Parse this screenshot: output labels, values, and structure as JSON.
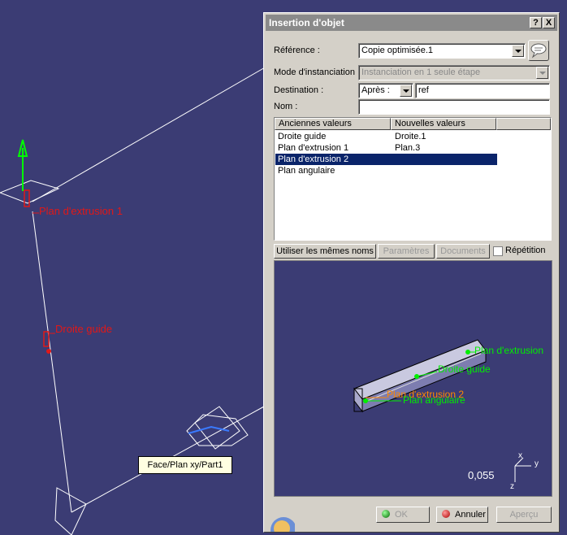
{
  "viewport": {
    "labels": {
      "plan_extrusion_1": "Plan d'extrusion 1",
      "droite_guide": "Droite guide"
    },
    "tooltip": "Face/Plan xy/Part1"
  },
  "dialog": {
    "title": "Insertion d'objet",
    "help_button": "?",
    "close_button": "X",
    "reference": {
      "label": "Référence :",
      "value": "Copie optimisée.1"
    },
    "mode": {
      "label": "Mode d'instanciation :",
      "value": "Instanciation en 1 seule étape"
    },
    "destination": {
      "label": "Destination :",
      "position": "Après :",
      "value": "ref"
    },
    "nom": {
      "label": "Nom :",
      "value": ""
    },
    "table": {
      "headers": [
        "Anciennes valeurs",
        "Nouvelles valeurs"
      ],
      "rows": [
        {
          "old": "Droite guide",
          "new": "Droite.1"
        },
        {
          "old": "Plan d'extrusion 1",
          "new": "Plan.3"
        },
        {
          "old": "Plan d'extrusion 2",
          "new": ""
        },
        {
          "old": "Plan angulaire",
          "new": ""
        }
      ],
      "selected_index": 2
    },
    "buttons": {
      "same_names": "Utiliser les mêmes noms",
      "parametres": "Paramètres",
      "documents": "Documents",
      "repetition": "Répétition"
    },
    "preview": {
      "labels": {
        "plan_extrusion": "Plan d'extrusion",
        "droite_guide": "Droite guide",
        "plan_extrusion_2": "Plan d'extrusion 2",
        "plan_angulaire": "Plan angulaire"
      },
      "scale": "0,055",
      "axes": {
        "x": "x",
        "y": "y",
        "z": "z"
      }
    },
    "footer": {
      "ok": "OK",
      "annuler": "Annuler",
      "apercu": "Aperçu"
    }
  },
  "colors": {
    "background": "#3b3c74",
    "selection": "#0a246a",
    "red_label": "#e01818",
    "green_label": "#00ee00",
    "orange_label": "#ff8800"
  }
}
